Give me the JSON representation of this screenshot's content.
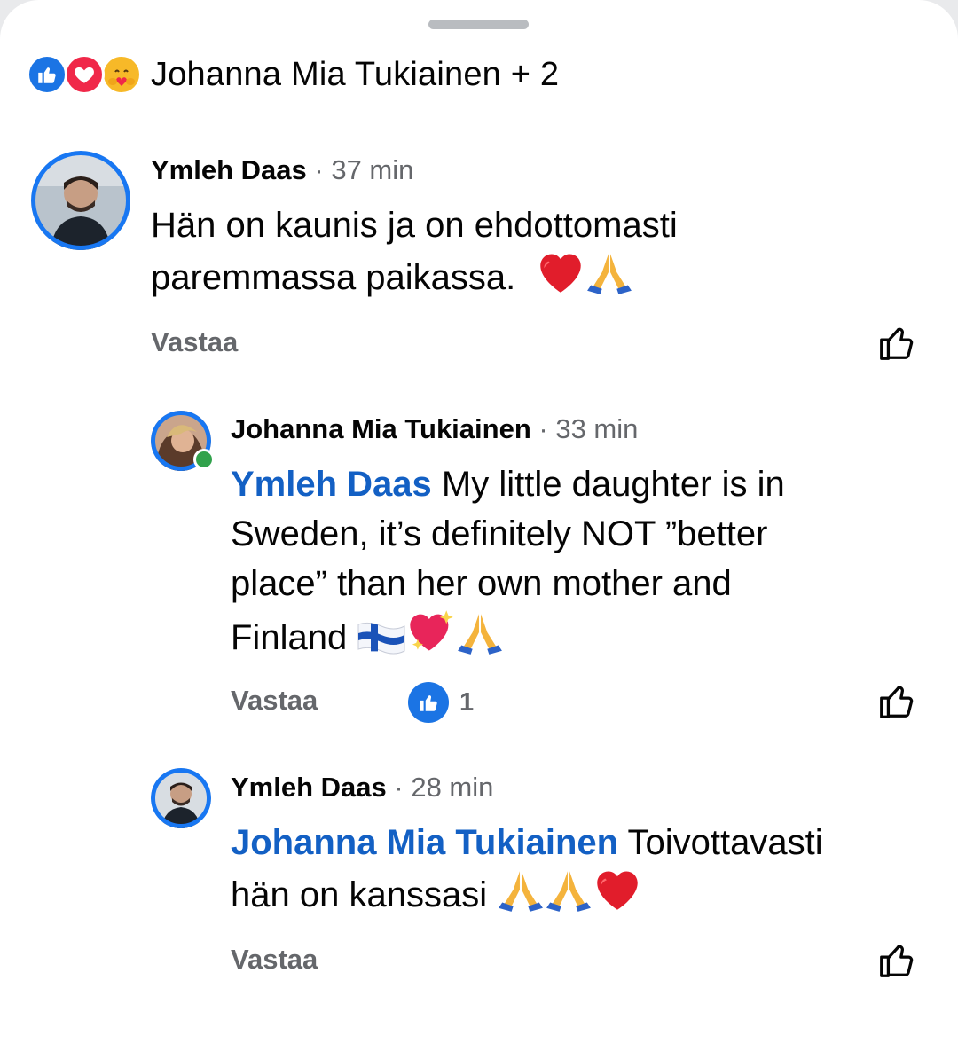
{
  "reactions": {
    "icons": [
      "like-icon",
      "love-icon",
      "care-icon"
    ],
    "names": "Johanna Mia Tukiainen + 2"
  },
  "comments": [
    {
      "author": "Ymleh Daas",
      "time": "· 37 min",
      "text_line1": "Hän on kaunis ja on ehdottomasti",
      "text_line2": "paremmassa paikassa.",
      "emojis": [
        "heart-emoji",
        "pray-emoji"
      ],
      "reply_label": "Vastaa"
    },
    {
      "author": "Johanna Mia Tukiainen",
      "time": "· 33 min",
      "mention": "Ymleh Daas",
      "text_line1": " My little daughter is in",
      "text_line2": "Sweden, it’s definitely NOT ”better",
      "text_line3": "place” than her own mother and",
      "text_line4": "Finland",
      "emojis": [
        "finland-flag-emoji",
        "sparkling-heart-emoji",
        "pray-emoji"
      ],
      "reply_label": "Vastaa",
      "like_count": "1"
    },
    {
      "author": "Ymleh Daas",
      "time": "· 28 min",
      "mention": "Johanna Mia Tukiainen",
      "text_line1": " Toivottavasti",
      "text_line2": "hän on kanssasi",
      "emojis": [
        "pray-emoji",
        "pray-emoji",
        "heart-emoji"
      ],
      "reply_label": "Vastaa"
    }
  ],
  "colors": {
    "accent": "#1877f2",
    "mention": "#1360c4",
    "secondary_text": "#65676b",
    "online": "#31a24c"
  }
}
